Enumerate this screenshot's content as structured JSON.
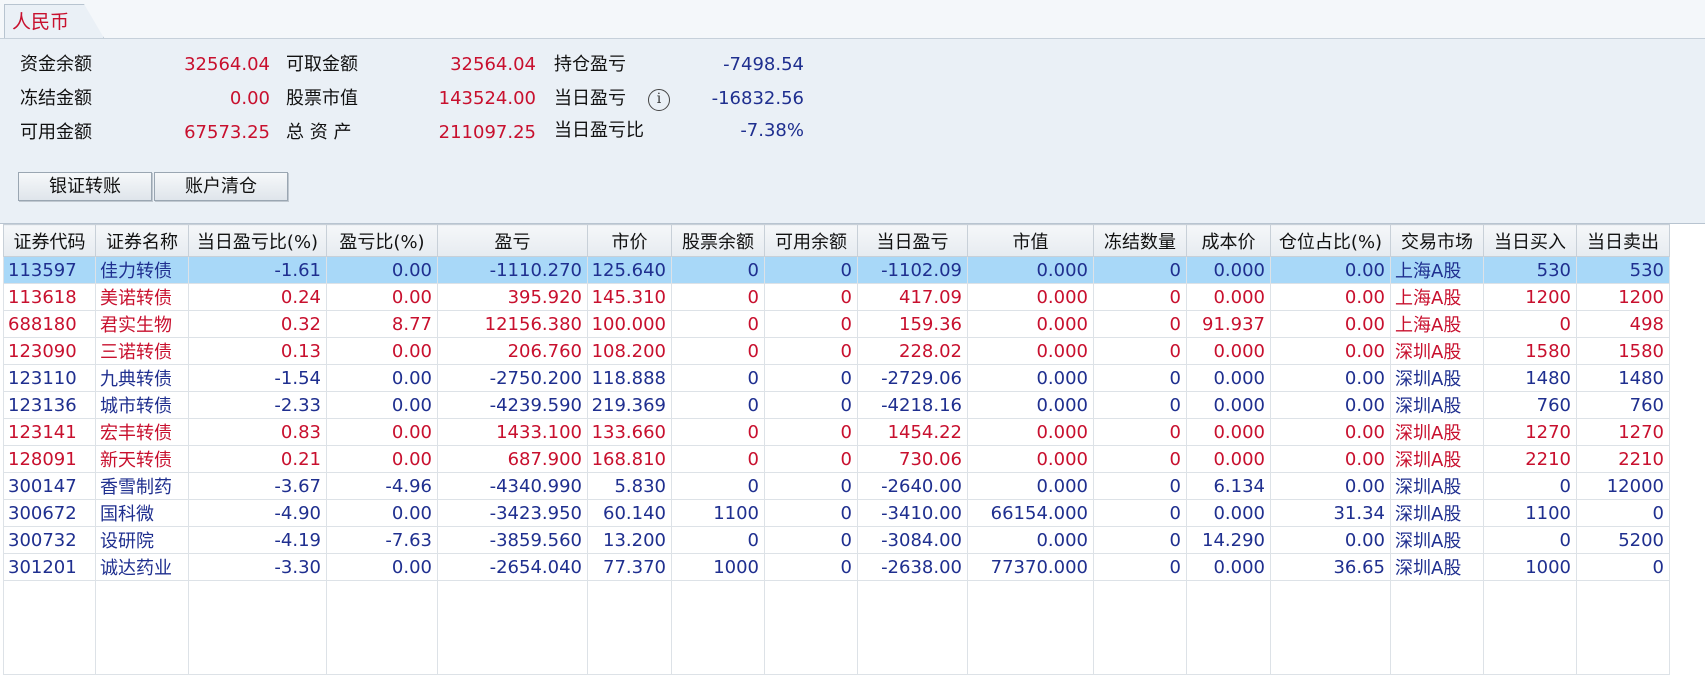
{
  "tab": {
    "label": "人民币"
  },
  "summary": {
    "fund_balance_label": "资金余额",
    "fund_balance": "32564.04",
    "frozen_label": "冻结金额",
    "frozen": "0.00",
    "available_label": "可用金额",
    "available": "67573.25",
    "withdrawable_label": "可取金额",
    "withdrawable": "32564.04",
    "stock_value_label": "股票市值",
    "stock_value": "143524.00",
    "total_assets_label": "总 资 产",
    "total_assets": "211097.25",
    "position_pl_label": "持仓盈亏",
    "position_pl": "-7498.54",
    "daily_pl_label": "当日盈亏",
    "daily_pl": "-16832.56",
    "daily_pl_ratio_label": "当日盈亏比",
    "daily_pl_ratio": "-7.38%",
    "info_icon": "i"
  },
  "buttons": {
    "transfer": "银证转账",
    "clear": "账户清仓"
  },
  "table": {
    "columns": [
      "证券代码",
      "证券名称",
      "当日盈亏比(%)",
      "盈亏比(%)",
      "盈亏",
      "市价",
      "股票余额",
      "可用余额",
      "当日盈亏",
      "市值",
      "冻结数量",
      "成本价",
      "仓位占比(%)",
      "交易市场",
      "当日买入",
      "当日卖出"
    ],
    "rows": [
      [
        "113597",
        "佳力转债",
        "-1.61",
        "0.00",
        "-1110.270",
        "125.640",
        "0",
        "0",
        "-1102.09",
        "0.000",
        "0",
        "0.000",
        "0.00",
        "上海A股",
        "530",
        "530"
      ],
      [
        "113618",
        "美诺转债",
        "0.24",
        "0.00",
        "395.920",
        "145.310",
        "0",
        "0",
        "417.09",
        "0.000",
        "0",
        "0.000",
        "0.00",
        "上海A股",
        "1200",
        "1200"
      ],
      [
        "688180",
        "君实生物",
        "0.32",
        "8.77",
        "12156.380",
        "100.000",
        "0",
        "0",
        "159.36",
        "0.000",
        "0",
        "91.937",
        "0.00",
        "上海A股",
        "0",
        "498"
      ],
      [
        "123090",
        "三诺转债",
        "0.13",
        "0.00",
        "206.760",
        "108.200",
        "0",
        "0",
        "228.02",
        "0.000",
        "0",
        "0.000",
        "0.00",
        "深圳A股",
        "1580",
        "1580"
      ],
      [
        "123110",
        "九典转债",
        "-1.54",
        "0.00",
        "-2750.200",
        "118.888",
        "0",
        "0",
        "-2729.06",
        "0.000",
        "0",
        "0.000",
        "0.00",
        "深圳A股",
        "1480",
        "1480"
      ],
      [
        "123136",
        "城市转债",
        "-2.33",
        "0.00",
        "-4239.590",
        "219.369",
        "0",
        "0",
        "-4218.16",
        "0.000",
        "0",
        "0.000",
        "0.00",
        "深圳A股",
        "760",
        "760"
      ],
      [
        "123141",
        "宏丰转债",
        "0.83",
        "0.00",
        "1433.100",
        "133.660",
        "0",
        "0",
        "1454.22",
        "0.000",
        "0",
        "0.000",
        "0.00",
        "深圳A股",
        "1270",
        "1270"
      ],
      [
        "128091",
        "新天转债",
        "0.21",
        "0.00",
        "687.900",
        "168.810",
        "0",
        "0",
        "730.06",
        "0.000",
        "0",
        "0.000",
        "0.00",
        "深圳A股",
        "2210",
        "2210"
      ],
      [
        "300147",
        "香雪制药",
        "-3.67",
        "-4.96",
        "-4340.990",
        "5.830",
        "0",
        "0",
        "-2640.00",
        "0.000",
        "0",
        "6.134",
        "0.00",
        "深圳A股",
        "0",
        "12000"
      ],
      [
        "300672",
        "国科微",
        "-4.90",
        "0.00",
        "-3423.950",
        "60.140",
        "1100",
        "0",
        "-3410.00",
        "66154.000",
        "0",
        "0.000",
        "31.34",
        "深圳A股",
        "1100",
        "0"
      ],
      [
        "300732",
        "设研院",
        "-4.19",
        "-7.63",
        "-3859.560",
        "13.200",
        "0",
        "0",
        "-3084.00",
        "0.000",
        "0",
        "14.290",
        "0.00",
        "深圳A股",
        "0",
        "5200"
      ],
      [
        "301201",
        "诚达药业",
        "-3.30",
        "0.00",
        "-2654.040",
        "77.370",
        "1000",
        "0",
        "-2638.00",
        "77370.000",
        "0",
        "0.000",
        "36.65",
        "深圳A股",
        "1000",
        "0"
      ]
    ],
    "row_trend": [
      "down",
      "up",
      "up",
      "up",
      "down",
      "down",
      "up",
      "up",
      "down",
      "down",
      "down",
      "down"
    ],
    "selected_row": 0
  }
}
